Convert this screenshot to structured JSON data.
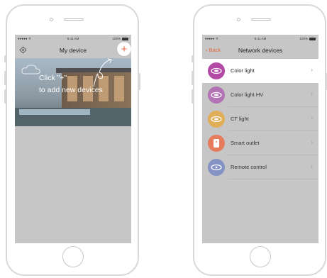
{
  "left_phone": {
    "status": {
      "signal": "●●●●● ᯤ",
      "time": "9:41 AM",
      "battery": "100%"
    },
    "nav": {
      "title": "My device",
      "add_button": "+"
    },
    "hero": {
      "line1": "Click \"+\"",
      "line2": "to add new devices"
    }
  },
  "right_phone": {
    "status": {
      "signal": "●●●●● ᯤ",
      "time": "9:41 AM",
      "battery": "100%"
    },
    "nav": {
      "back_label": "Back",
      "title": "Network devices"
    },
    "devices": [
      {
        "label": "Color light",
        "icon": "color-light-icon",
        "color": "#b24aa6"
      },
      {
        "label": "Color light HV",
        "icon": "color-light-hv-icon",
        "color": "#b274b4"
      },
      {
        "label": "CT light",
        "icon": "ct-light-icon",
        "color": "#e0ae57"
      },
      {
        "label": "Smart outlet",
        "icon": "smart-outlet-icon",
        "color": "#e57c5b"
      },
      {
        "label": "Remote control",
        "icon": "remote-control-icon",
        "color": "#8592c4"
      }
    ]
  },
  "colors": {
    "accent": "#e2693c",
    "screen_bg": "#c6c6c6"
  }
}
